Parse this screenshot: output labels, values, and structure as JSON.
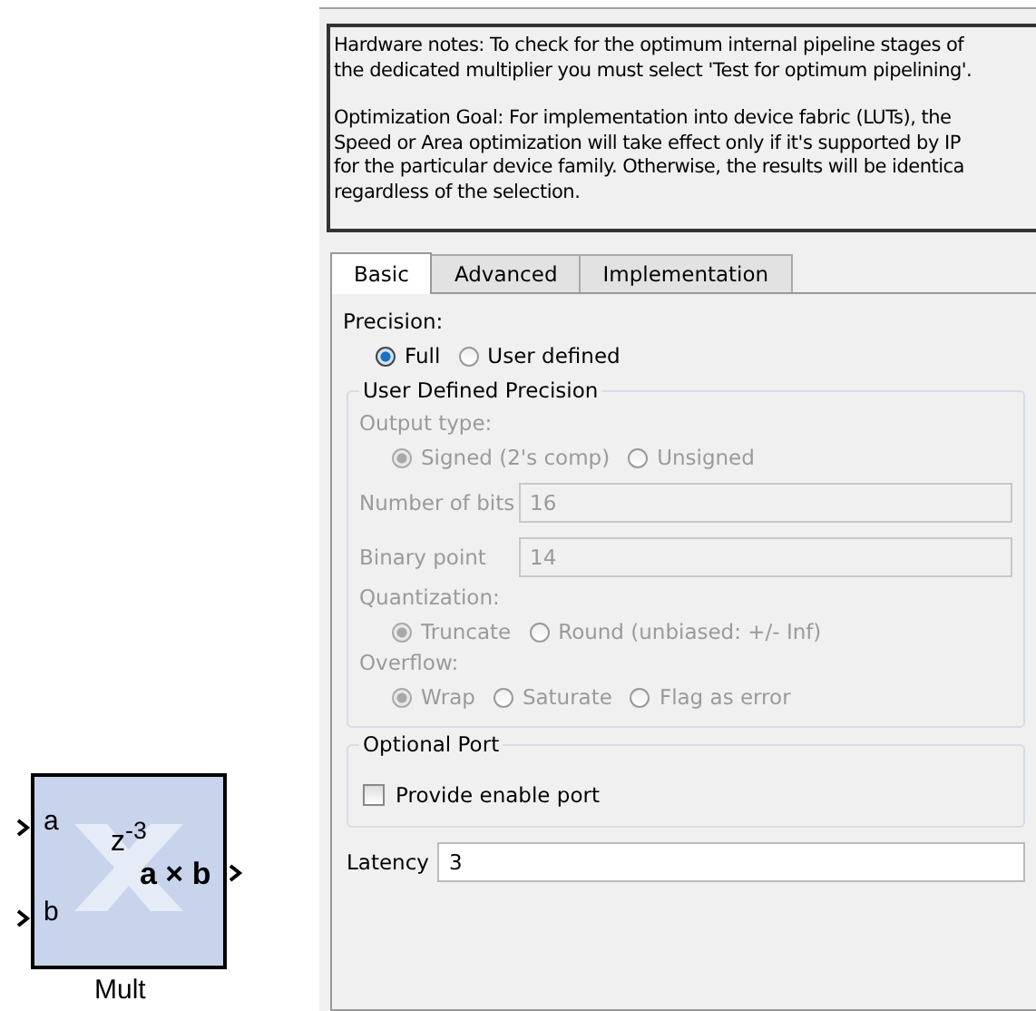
{
  "block": {
    "inputs": [
      "a",
      "b"
    ],
    "delay": "z$^{-3}$",
    "operation": "a × b",
    "label": "Mult"
  },
  "notes": [
    [
      "Hardware notes: To check for the optimum internal pipeline stages of",
      "the dedicated multiplier you must select 'Test for optimum pipelining'."
    ],
    [
      "Optimization Goal: For implementation into device fabric (LUTs), the",
      "Speed or Area optimization will take effect only if it's supported by IP",
      "for the particular device family. Otherwise, the results will be identica",
      "regardless of the selection."
    ]
  ],
  "tabs": [
    {
      "label": "Basic",
      "selected": true
    },
    {
      "label": "Advanced",
      "selected": false
    },
    {
      "label": "Implementation",
      "selected": false
    }
  ],
  "precision": {
    "label": "Precision:",
    "options": [
      {
        "label": "Full",
        "selected": true
      },
      {
        "label": "User defined",
        "selected": false
      }
    ]
  },
  "user_defined_precision": {
    "title": "User Defined Precision",
    "disabled": true,
    "output_type": {
      "label": "Output type:",
      "options": [
        {
          "label": "Signed  (2's comp)",
          "selected": true
        },
        {
          "label": "Unsigned",
          "selected": false
        }
      ]
    },
    "fields": [
      {
        "label": "Number of bits",
        "value": "16"
      },
      {
        "label": "Binary point",
        "value": "14"
      }
    ],
    "quantization": {
      "label": "Quantization:",
      "options": [
        {
          "label": "Truncate",
          "selected": true
        },
        {
          "label": "Round  (unbiased: +/- Inf)",
          "selected": false
        }
      ]
    },
    "overflow": {
      "label": "Overflow:",
      "options": [
        {
          "label": "Wrap",
          "selected": true
        },
        {
          "label": "Saturate",
          "selected": false
        },
        {
          "label": "Flag as error",
          "selected": false
        }
      ]
    }
  },
  "optional_port": {
    "title": "Optional Port",
    "checkbox": {
      "label": "Provide enable port",
      "checked": false
    }
  },
  "latency": {
    "label": "Latency",
    "value": "3"
  }
}
